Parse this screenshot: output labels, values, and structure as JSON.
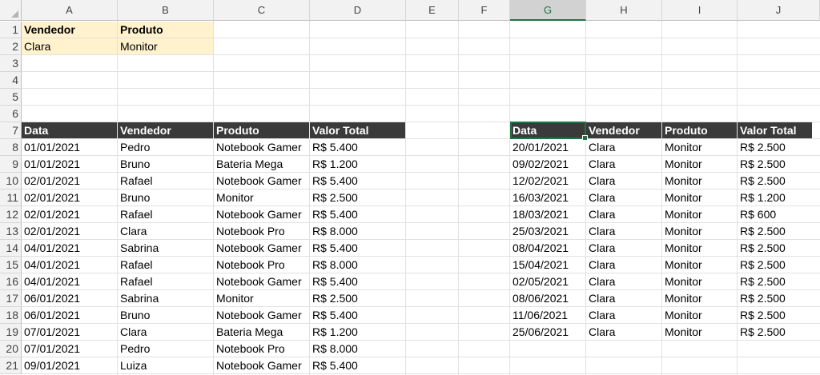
{
  "columns": [
    "A",
    "B",
    "C",
    "D",
    "E",
    "F",
    "G",
    "H",
    "I",
    "J"
  ],
  "rows": [
    "1",
    "2",
    "3",
    "4",
    "5",
    "6",
    "7",
    "8",
    "9",
    "10",
    "11",
    "12",
    "13",
    "14",
    "15",
    "16",
    "17",
    "18",
    "19",
    "20",
    "21"
  ],
  "criteria": {
    "headers": [
      "Vendedor",
      "Produto"
    ],
    "values": [
      "Clara",
      "Monitor"
    ]
  },
  "source_table": {
    "headers": [
      "Data",
      "Vendedor",
      "Produto",
      "Valor Total"
    ],
    "rows": [
      [
        "01/01/2021",
        "Pedro",
        "Notebook Gamer",
        "R$ 5.400"
      ],
      [
        "01/01/2021",
        "Bruno",
        "Bateria Mega",
        "R$ 1.200"
      ],
      [
        "02/01/2021",
        "Rafael",
        "Notebook Gamer",
        "R$ 5.400"
      ],
      [
        "02/01/2021",
        "Bruno",
        "Monitor",
        "R$ 2.500"
      ],
      [
        "02/01/2021",
        "Rafael",
        "Notebook Gamer",
        "R$ 5.400"
      ],
      [
        "02/01/2021",
        "Clara",
        "Notebook Pro",
        "R$ 8.000"
      ],
      [
        "04/01/2021",
        "Sabrina",
        "Notebook Gamer",
        "R$ 5.400"
      ],
      [
        "04/01/2021",
        "Rafael",
        "Notebook Pro",
        "R$ 8.000"
      ],
      [
        "04/01/2021",
        "Rafael",
        "Notebook Gamer",
        "R$ 5.400"
      ],
      [
        "06/01/2021",
        "Sabrina",
        "Monitor",
        "R$ 2.500"
      ],
      [
        "06/01/2021",
        "Bruno",
        "Notebook Gamer",
        "R$ 5.400"
      ],
      [
        "07/01/2021",
        "Clara",
        "Bateria Mega",
        "R$ 1.200"
      ],
      [
        "07/01/2021",
        "Pedro",
        "Notebook Pro",
        "R$ 8.000"
      ],
      [
        "09/01/2021",
        "Luiza",
        "Notebook Gamer",
        "R$ 5.400"
      ]
    ]
  },
  "filtered_table": {
    "headers": [
      "Data",
      "Vendedor",
      "Produto",
      "Valor Total"
    ],
    "rows": [
      [
        "20/01/2021",
        "Clara",
        "Monitor",
        "R$ 2.500"
      ],
      [
        "09/02/2021",
        "Clara",
        "Monitor",
        "R$ 2.500"
      ],
      [
        "12/02/2021",
        "Clara",
        "Monitor",
        "R$ 2.500"
      ],
      [
        "16/03/2021",
        "Clara",
        "Monitor",
        "R$ 1.200"
      ],
      [
        "18/03/2021",
        "Clara",
        "Monitor",
        "R$ 600"
      ],
      [
        "25/03/2021",
        "Clara",
        "Monitor",
        "R$ 2.500"
      ],
      [
        "08/04/2021",
        "Clara",
        "Monitor",
        "R$ 2.500"
      ],
      [
        "15/04/2021",
        "Clara",
        "Monitor",
        "R$ 2.500"
      ],
      [
        "02/05/2021",
        "Clara",
        "Monitor",
        "R$ 2.500"
      ],
      [
        "08/06/2021",
        "Clara",
        "Monitor",
        "R$ 2.500"
      ],
      [
        "11/06/2021",
        "Clara",
        "Monitor",
        "R$ 2.500"
      ],
      [
        "25/06/2021",
        "Clara",
        "Monitor",
        "R$ 2.500"
      ]
    ]
  },
  "selected_cell": "G7",
  "colors": {
    "header_band": "#3a3a3a",
    "criteria_band": "#fff2cc",
    "selection": "#217346"
  }
}
